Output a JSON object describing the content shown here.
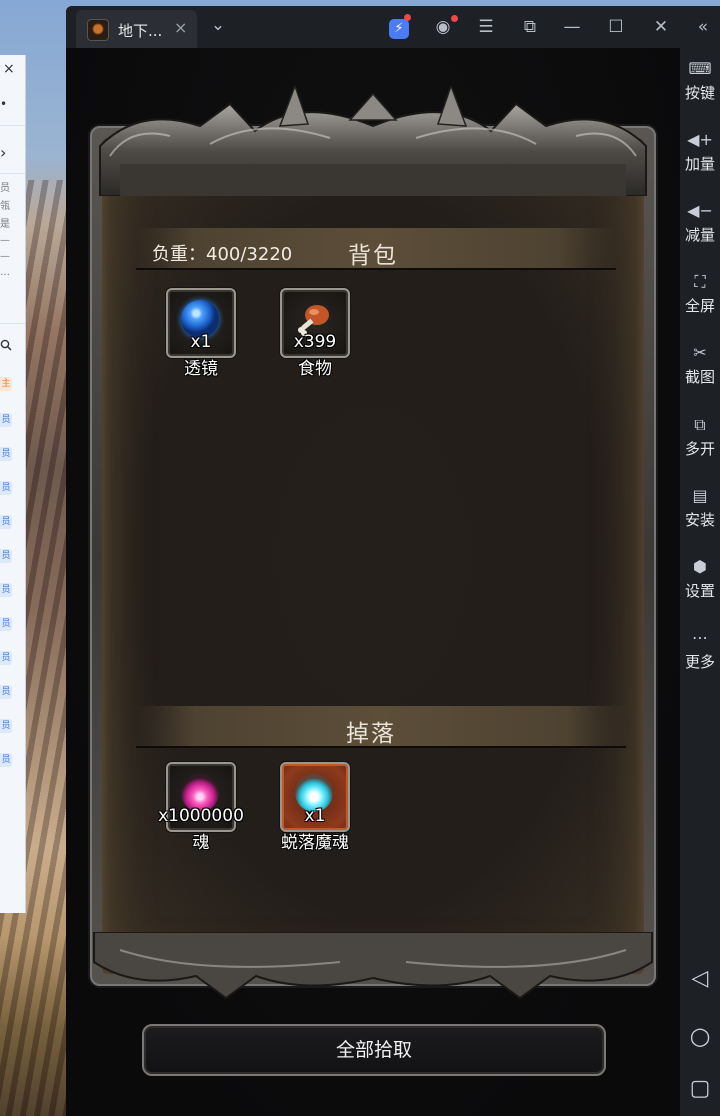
{
  "window": {
    "tab_title": "地下...",
    "tab_close": "×",
    "tab_dropdown": "⌄"
  },
  "titlebar_icons": {
    "bolt": "⚡",
    "account": "◉",
    "menu": "☰",
    "restore": "⧉",
    "minimize": "—",
    "maximize": "☐",
    "close": "✕",
    "collapse": "«"
  },
  "sidebar": {
    "items": [
      {
        "label": "按键",
        "icon": "keyboard-icon",
        "glyph": "⌨"
      },
      {
        "label": "加量",
        "icon": "volume-up-icon",
        "glyph": "◀+"
      },
      {
        "label": "减量",
        "icon": "volume-down-icon",
        "glyph": "◀−"
      },
      {
        "label": "全屏",
        "icon": "fullscreen-icon",
        "glyph": "⛶"
      },
      {
        "label": "截图",
        "icon": "scissors-icon",
        "glyph": "✂"
      },
      {
        "label": "多开",
        "icon": "multi-instance-icon",
        "glyph": "⧉"
      },
      {
        "label": "安装",
        "icon": "apk-install-icon",
        "glyph": "▤"
      },
      {
        "label": "设置",
        "icon": "settings-icon",
        "glyph": "⬢"
      },
      {
        "label": "更多",
        "icon": "more-icon",
        "glyph": "⋯"
      }
    ],
    "nav": {
      "back": "◁",
      "home": "○",
      "recent": "▢"
    }
  },
  "left_panel": {
    "close": "×",
    "dot": "•",
    "chevron": "›",
    "snippets": [
      "员",
      "瓴",
      "是",
      "—",
      "—",
      "…"
    ],
    "search": "⌕",
    "tags": [
      "主",
      "员",
      "员",
      "员",
      "员",
      "员",
      "员",
      "员",
      "员",
      "员",
      "员",
      "员"
    ]
  },
  "game": {
    "backpack": {
      "weight_label": "负重：400/3220",
      "title": "背包",
      "items": [
        {
          "name": "透镜",
          "count": "x1",
          "icon": "blue-orb-lens-icon",
          "color": "#2a7de1"
        },
        {
          "name": "食物",
          "count": "x399",
          "icon": "drumstick-food-icon",
          "color": "#c2562a"
        }
      ]
    },
    "drops": {
      "title": "掉落",
      "items": [
        {
          "name": "魂",
          "count": "x1000000",
          "icon": "pink-soul-flame-icon",
          "color": "#e0359a"
        },
        {
          "name": "蜕落魔魂",
          "count": "x1",
          "icon": "cyan-soul-flame-icon",
          "color": "#36d3e6"
        }
      ]
    },
    "pick_all_label": "全部拾取"
  }
}
